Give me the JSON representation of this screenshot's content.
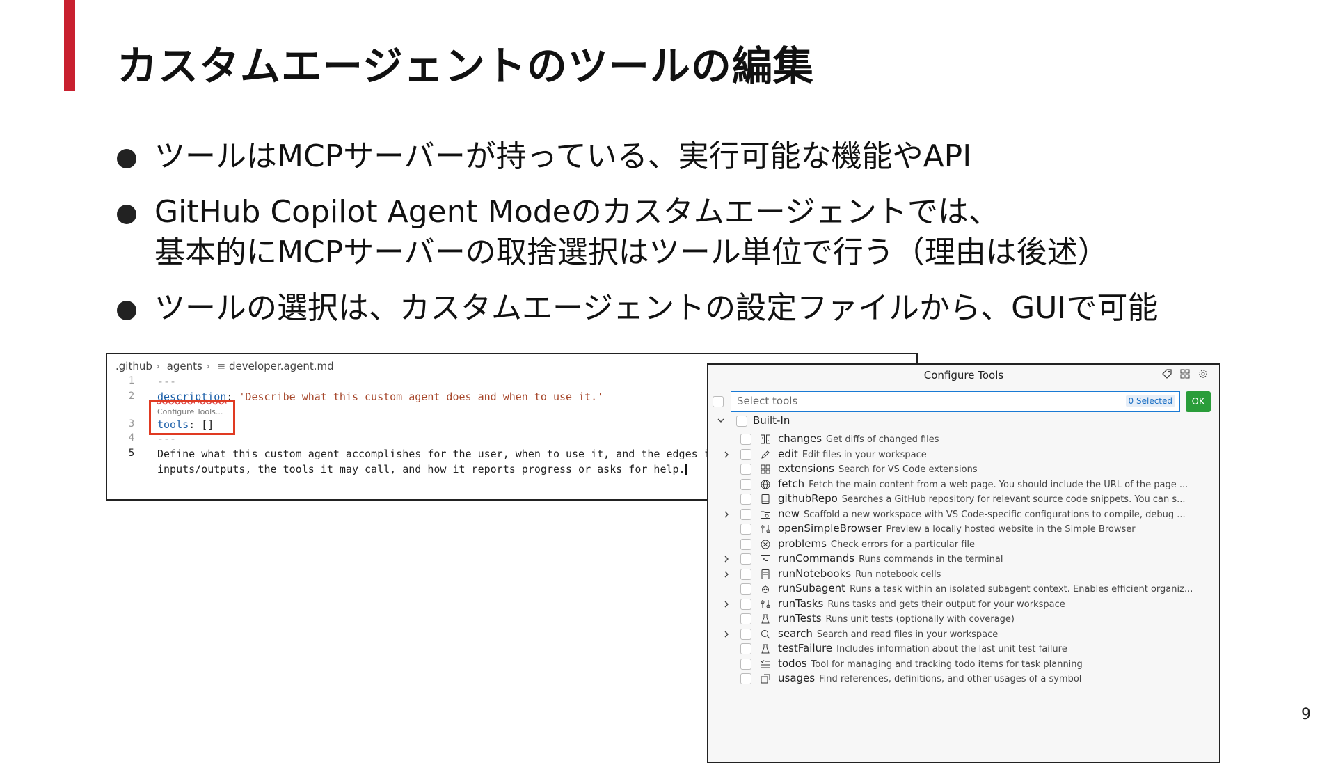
{
  "slide": {
    "title": "カスタムエージェントのツールの編集",
    "bullets": [
      {
        "lines": [
          "ツールはMCPサーバーが持っている、実行可能な機能やAPI"
        ]
      },
      {
        "lines": [
          "GitHub Copilot Agent Modeのカスタムエージェントでは、",
          "基本的にMCPサーバーの取捨選択はツール単位で行う（理由は後述）"
        ]
      },
      {
        "lines": [
          "ツールの選択は、カスタムエージェントの設定ファイルから、GUIで可能"
        ]
      }
    ],
    "page_number": "9",
    "accent_color": "#c8202f"
  },
  "editor": {
    "breadcrumb": [
      ".github",
      "agents",
      "developer.agent.md"
    ],
    "lines": [
      {
        "num": "1",
        "text": "---"
      },
      {
        "num": "2",
        "key": "description",
        "value": "'Describe what this custom agent does and when to use it.'"
      },
      {
        "hint": "Configure Tools..."
      },
      {
        "num": "3",
        "key": "tools",
        "value": "[]"
      },
      {
        "num": "4",
        "text": "---"
      },
      {
        "num": "5",
        "text": "Define what this custom agent accomplishes for the user, when to use it, and the edges it"
      },
      {
        "num": "",
        "text": "inputs/outputs, the tools it may call, and how it reports progress or asks for help."
      }
    ],
    "highlight_color": "#e03a22"
  },
  "configure_tools": {
    "title": "Configure Tools",
    "search_placeholder": "Select tools",
    "selected_badge": "0 Selected",
    "ok_label": "OK",
    "group_label": "Built-In",
    "tools": [
      {
        "name": "changes",
        "desc": "Get diffs of changed files",
        "expandable": false,
        "icon": "diff-icon"
      },
      {
        "name": "edit",
        "desc": "Edit files in your workspace",
        "expandable": true,
        "icon": "pencil-icon"
      },
      {
        "name": "extensions",
        "desc": "Search for VS Code extensions",
        "expandable": false,
        "icon": "extensions-icon"
      },
      {
        "name": "fetch",
        "desc": "Fetch the main content from a web page. You should include the URL of the page ...",
        "expandable": false,
        "icon": "globe-icon"
      },
      {
        "name": "githubRepo",
        "desc": "Searches a GitHub repository for relevant source code snippets. You can s...",
        "expandable": false,
        "icon": "repo-icon"
      },
      {
        "name": "new",
        "desc": "Scaffold a new workspace with VS Code-specific configurations to compile, debug ...",
        "expandable": true,
        "icon": "new-folder-icon"
      },
      {
        "name": "openSimpleBrowser",
        "desc": "Preview a locally hosted website in the Simple Browser",
        "expandable": false,
        "icon": "tools-icon"
      },
      {
        "name": "problems",
        "desc": "Check errors for a particular file",
        "expandable": false,
        "icon": "error-icon"
      },
      {
        "name": "runCommands",
        "desc": "Runs commands in the terminal",
        "expandable": true,
        "icon": "terminal-icon"
      },
      {
        "name": "runNotebooks",
        "desc": "Run notebook cells",
        "expandable": true,
        "icon": "notebook-icon"
      },
      {
        "name": "runSubagent",
        "desc": "Runs a task within an isolated subagent context. Enables efficient organiz...",
        "expandable": false,
        "icon": "agent-icon"
      },
      {
        "name": "runTasks",
        "desc": "Runs tasks and gets their output for your workspace",
        "expandable": true,
        "icon": "tools-icon"
      },
      {
        "name": "runTests",
        "desc": "Runs unit tests (optionally with coverage)",
        "expandable": false,
        "icon": "beaker-icon"
      },
      {
        "name": "search",
        "desc": "Search and read files in your workspace",
        "expandable": true,
        "icon": "search-icon"
      },
      {
        "name": "testFailure",
        "desc": "Includes information about the last unit test failure",
        "expandable": false,
        "icon": "beaker-icon"
      },
      {
        "name": "todos",
        "desc": "Tool for managing and tracking todo items for task planning",
        "expandable": false,
        "icon": "checklist-icon"
      },
      {
        "name": "usages",
        "desc": "Find references, definitions, and other usages of a symbol",
        "expandable": false,
        "icon": "references-icon"
      }
    ]
  }
}
